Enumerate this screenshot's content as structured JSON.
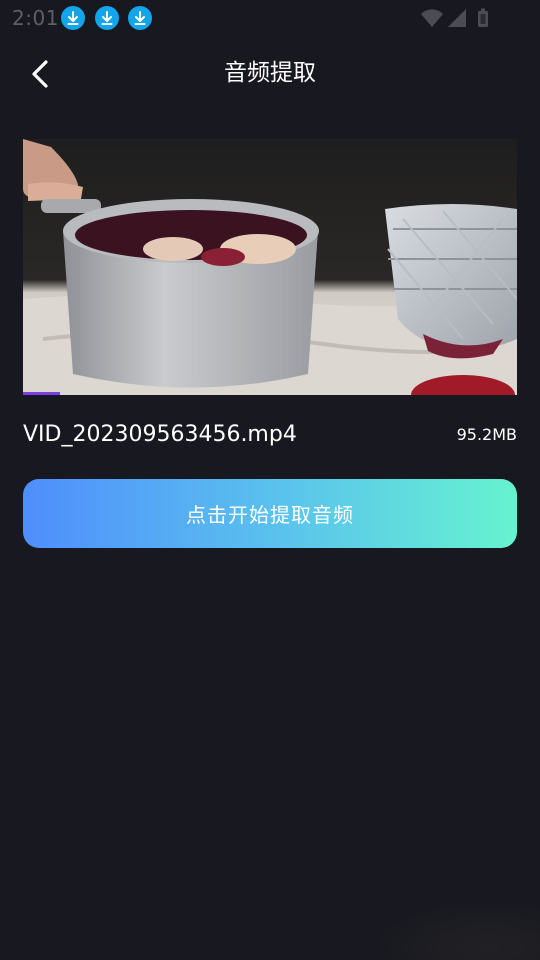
{
  "status_bar": {
    "time": "2:01",
    "notification_icons": [
      "download-icon",
      "download-icon",
      "download-icon"
    ],
    "system_icons": [
      "wifi-icon",
      "cell-signal-icon",
      "battery-icon"
    ]
  },
  "header": {
    "title": "音频提取",
    "back_icon": "chevron-left-icon"
  },
  "video": {
    "playback_progress": 0.075,
    "progress_color": "#7b3fe4"
  },
  "file": {
    "name": "VID_202309563456.mp4",
    "size": "95.2MB"
  },
  "action": {
    "extract_label": "点击开始提取音频",
    "gradient_start": "#4f8efd",
    "gradient_end": "#66f3cf"
  },
  "colors": {
    "background": "#181820",
    "notification_icon": "#13a5ea"
  }
}
